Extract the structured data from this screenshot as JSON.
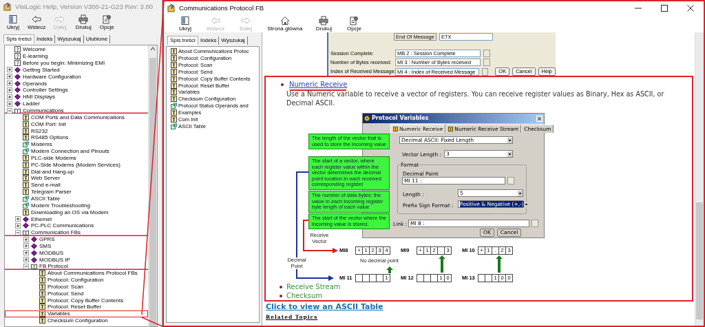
{
  "help_window": {
    "title": "VisiLogic Help, Version V300-21-G23 Rev: 3.00",
    "toolbar": [
      {
        "label": "Ukryj",
        "kind": "hide",
        "disabled": false
      },
      {
        "label": "Wstecz",
        "kind": "back",
        "disabled": false
      },
      {
        "label": "Dalej",
        "kind": "forward",
        "disabled": true
      },
      {
        "label": "Drukuj",
        "kind": "print",
        "disabled": false
      },
      {
        "label": "Opcje",
        "kind": "options",
        "disabled": false
      }
    ],
    "tabs": [
      {
        "label": "Spis treści",
        "selected": true
      },
      {
        "label": "Indeks",
        "selected": false
      },
      {
        "label": "Wyszukaj",
        "selected": false
      },
      {
        "label": "Ulubione",
        "selected": false
      }
    ],
    "tree": [
      {
        "label": "Welcome",
        "kind": "topic"
      },
      {
        "label": "E-learning",
        "kind": "topic"
      },
      {
        "label": "Before you begin: Minimizing EMI",
        "kind": "topic"
      },
      {
        "label": "Getting Started",
        "kind": "book",
        "expanded": false
      },
      {
        "label": "Hardware Configuration",
        "kind": "book",
        "expanded": false
      },
      {
        "label": "Operands",
        "kind": "book",
        "expanded": false
      },
      {
        "label": "Controller Settings",
        "kind": "book",
        "expanded": false
      },
      {
        "label": "HMI Displays",
        "kind": "book",
        "expanded": false
      },
      {
        "label": "Ladder",
        "kind": "book",
        "expanded": false
      },
      {
        "label": "Communications",
        "kind": "book",
        "expanded": true,
        "underlined": true,
        "children": [
          {
            "label": "COM Ports and Data Communications",
            "kind": "page"
          },
          {
            "label": "COM Port: Init",
            "kind": "page"
          },
          {
            "label": "RS232",
            "kind": "page"
          },
          {
            "label": "RS485 Options",
            "kind": "page"
          },
          {
            "label": "Modems",
            "kind": "wizard"
          },
          {
            "label": "Modem Connection and Pinouts",
            "kind": "wizard"
          },
          {
            "label": "PLC-side Modems",
            "kind": "page"
          },
          {
            "label": "PC-Side Modems (Modem Services)",
            "kind": "page"
          },
          {
            "label": "Dial and Hang-up",
            "kind": "page"
          },
          {
            "label": "Web Server",
            "kind": "page"
          },
          {
            "label": "Send e-mail",
            "kind": "page"
          },
          {
            "label": "Telegram Parser",
            "kind": "page"
          },
          {
            "label": "ASCII Table",
            "kind": "wizard"
          },
          {
            "label": "Modem Troubleshooting",
            "kind": "wizard"
          },
          {
            "label": "Downloading an OS via Modem",
            "kind": "page"
          },
          {
            "label": "Ethernet",
            "kind": "book",
            "expanded": false
          },
          {
            "label": "PC-PLC Communications",
            "kind": "book",
            "expanded": false
          },
          {
            "label": "Communication FBs",
            "kind": "book",
            "expanded": true,
            "underlined": true,
            "children": [
              {
                "label": "GPRS",
                "kind": "book",
                "expanded": false
              },
              {
                "label": "SMS",
                "kind": "book",
                "expanded": false
              },
              {
                "label": "MODBUS",
                "kind": "book",
                "expanded": false
              },
              {
                "label": "MODBUS IP",
                "kind": "book",
                "expanded": false
              },
              {
                "label": "FB Protocol",
                "kind": "book",
                "expanded": true,
                "underlined": true,
                "children": [
                  {
                    "label": "About Communications Protocol FBs",
                    "kind": "page"
                  },
                  {
                    "label": "Protocol: Configuration",
                    "kind": "page"
                  },
                  {
                    "label": "Protocol: Scan",
                    "kind": "page"
                  },
                  {
                    "label": "Protocol: Send",
                    "kind": "page"
                  },
                  {
                    "label": "Protocol: Copy Buffer Contents",
                    "kind": "page"
                  },
                  {
                    "label": "Protocol: Reset Buffer",
                    "kind": "page"
                  },
                  {
                    "label": "Variables",
                    "kind": "page",
                    "boxed": true
                  },
                  {
                    "label": "Checksum Configuration",
                    "kind": "page"
                  }
                ]
              }
            ]
          }
        ]
      }
    ]
  },
  "topic_window": {
    "title": "Communications Protocol FB",
    "toolbar": [
      {
        "label": "Ukryj",
        "kind": "hide",
        "disabled": false
      },
      {
        "label": "Wstecz",
        "kind": "back",
        "disabled": true
      },
      {
        "label": "Dalej",
        "kind": "forward",
        "disabled": true
      },
      {
        "label": "Strona główna",
        "kind": "home",
        "disabled": false
      },
      {
        "label": "Drukuj",
        "kind": "print",
        "disabled": false
      },
      {
        "label": "Opcje",
        "kind": "options",
        "disabled": false
      }
    ],
    "tabs": [
      {
        "label": "Spis treści",
        "selected": true
      },
      {
        "label": "Indeks",
        "selected": false
      },
      {
        "label": "Wyszukaj",
        "selected": false
      }
    ],
    "contents": [
      {
        "label": "About Communications Protoc",
        "kind": "page"
      },
      {
        "label": "Protocol: Configuration",
        "kind": "page"
      },
      {
        "label": "Protocol: Scan",
        "kind": "page"
      },
      {
        "label": "Protocol: Send",
        "kind": "page"
      },
      {
        "label": "Protocol: Copy Buffer Contents",
        "kind": "page"
      },
      {
        "label": "Protocol: Reset Buffer",
        "kind": "page"
      },
      {
        "label": "Variables",
        "kind": "page"
      },
      {
        "label": "Checksum Configuration",
        "kind": "page"
      },
      {
        "label": "Protocol Status Operands and",
        "kind": "wizard"
      },
      {
        "label": "Examples",
        "kind": "page"
      },
      {
        "label": "Com Init",
        "kind": "page"
      },
      {
        "label": "ASCII Table",
        "kind": "wizard"
      }
    ],
    "dialog_excerpt": {
      "end_label": "End Of Message",
      "end_value": "ETX",
      "fields": [
        {
          "label": "Session Complete:",
          "value": "MB 2 : Session Complete"
        },
        {
          "label": "Number of Bytes received:",
          "value": "MI 3 : Number of Bytes received"
        },
        {
          "label": "Index of Received Message:",
          "value": "MI 4 : Index of Received Message"
        }
      ],
      "buttons": [
        "OK",
        "Cancel",
        "Help"
      ]
    },
    "numeric_receive": {
      "link": "Numeric Receive",
      "description": "Use a Numeric variable to receive a vector of registers. You can receive register values as Binary, Hex as ASCII, or Decimal ASCII.",
      "dialog": {
        "title": "Protocol Variables",
        "tabs": [
          {
            "label": "Numeric Receive",
            "selected": true,
            "has_icon": true
          },
          {
            "label": "Numeric Receive Stream",
            "selected": false,
            "has_icon": true
          },
          {
            "label": "Checksum",
            "selected": false,
            "has_icon": false
          }
        ],
        "type_value": "Decimal ASCII: Fixed Length",
        "vector_length_label": "Vector Length :",
        "vector_length_value": "3",
        "format_legend": "Format",
        "decimal_label": "Decimal Point",
        "decimal_value": "MI 11 :",
        "length_label": "Length :",
        "length_value": "5",
        "sign_label": "Prefix Sign Format :",
        "sign_value": "Positive & Negative (+,-)",
        "link_label": "Link :",
        "link_value": "MI 8 :",
        "buttons": [
          "OK",
          "Cancel"
        ]
      },
      "callouts": [
        "The length of the vector that is used to store the incoming value",
        "The start of a vector, where each register value within the vector determines the decimal point location in each received corresponding register",
        "The number of data bytes: the value in each incoming register byte length of each value",
        "The start of the vector where the incoming value is stored."
      ],
      "receive_vector_label": "Receive Vector",
      "decimal_point_label": "Decimal Point",
      "no_decimal_label": "No decimal point",
      "receive_registers": [
        {
          "name": "MI8",
          "cells": [
            "+",
            "1",
            "2",
            "3",
            "4"
          ]
        },
        {
          "name": "MI9",
          "cells": [
            "+",
            "1",
            "2",
            ".",
            "3"
          ]
        },
        {
          "name": "MI 10",
          "cells": [
            "+",
            "1",
            ".",
            "2",
            "3"
          ]
        }
      ],
      "decimal_registers": [
        {
          "name": "MI 11",
          "cells": [
            "1"
          ]
        },
        {
          "name": "MI 12",
          "cells": [
            "1",
            "0"
          ]
        },
        {
          "name": "MI 13",
          "cells": [
            "1",
            "0",
            "0"
          ]
        }
      ],
      "more": [
        "Receive Stream",
        "Checksum"
      ]
    },
    "ascii_link": "Click to view an ASCII Table",
    "related_topics": "Related Topics"
  }
}
